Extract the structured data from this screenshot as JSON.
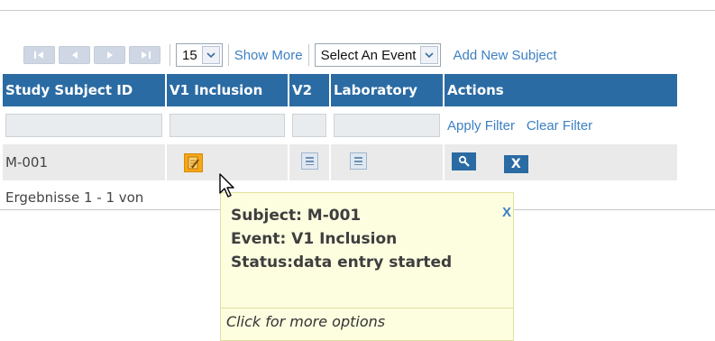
{
  "toolbar": {
    "page_size": "15",
    "show_more": "Show More",
    "event_select": "Select An Event",
    "add_new_subject": "Add New Subject"
  },
  "table": {
    "columns": [
      "Study Subject ID",
      "V1 Inclusion",
      "V2",
      "Laboratory",
      "Actions"
    ],
    "apply_filter": "Apply Filter",
    "clear_filter": "Clear Filter",
    "rows": [
      {
        "subject_id": "M-001",
        "remove_label": "X"
      }
    ],
    "results_text": "Ergebnisse 1 - 1 von"
  },
  "tooltip": {
    "subject": "Subject: M-001",
    "event": "Event: V1 Inclusion",
    "status": "Status:data entry started",
    "close": "X",
    "footer": "Click for more options"
  },
  "colors": {
    "header_bg": "#2b6ba3",
    "link": "#3d80c2",
    "status_data_entry_started": "#f3a81c",
    "tooltip_bg": "#fdfde0"
  }
}
